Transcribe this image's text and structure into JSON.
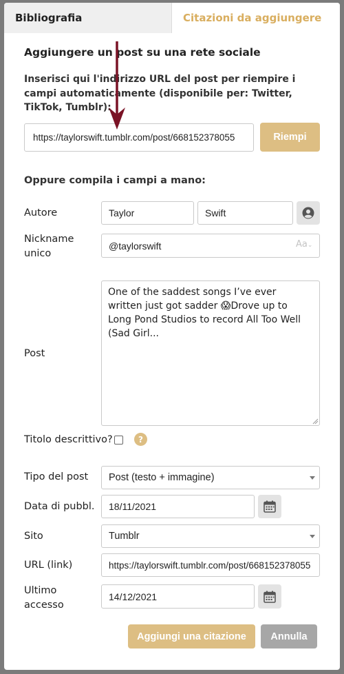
{
  "tabs": {
    "bibliography": "Bibliografia",
    "add_citations": "Citazioni da aggiungere"
  },
  "social": {
    "title": "Aggiungere un post su una rete sociale",
    "description": "Inserisci qui l'indirizzo URL del post per riempire i campi automaticamente (disponibile per: Twitter, TikTok, Tumblr):",
    "url_value": "https://taylorswift.tumblr.com/post/668152378055",
    "fill_button": "Riempi"
  },
  "manual": {
    "heading": "Oppure compila i campi a mano:"
  },
  "fields": {
    "author_label": "Autore",
    "author_first": "Taylor",
    "author_last": "Swift",
    "nickname_label": "Nickname unico",
    "nickname_value": "@taylorswift",
    "nickname_format": "Aa",
    "post_label": "Post",
    "post_value": "One of the saddest songs I’ve ever written just got sadder 😱Drove up to Long Pond Studios to record All Too Well (Sad Girl...",
    "descriptive_title_label": "Titolo descrittivo?",
    "help_symbol": "?",
    "post_type_label": "Tipo del post",
    "post_type_value": "Post (testo + immagine)",
    "pub_date_label": "Data di pubbl.",
    "pub_date_value": "18/11/2021",
    "site_label": "Sito",
    "site_value": "Tumblr",
    "url_label": "URL (link)",
    "url_value": "https://taylorswift.tumblr.com/post/668152378055",
    "last_access_label": "Ultimo accesso",
    "last_access_value": "14/12/2021"
  },
  "actions": {
    "add_citation": "Aggiungi una citazione",
    "cancel": "Annulla"
  },
  "colors": {
    "accent_gold": "#ddbe83",
    "tab_active_text": "#d9ae5f",
    "arrow": "#7a1326",
    "cancel_gray": "#a7a7a7"
  },
  "icons": {
    "user": "user-icon",
    "calendar": "calendar-icon",
    "arrow": "down-arrow-annotation"
  }
}
